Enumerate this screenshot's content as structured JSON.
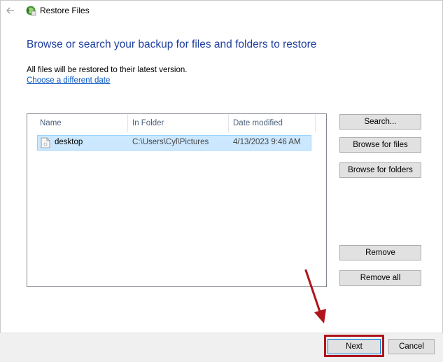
{
  "window": {
    "title": "Restore Files"
  },
  "heading": "Browse or search your backup for files and folders to restore",
  "info_text": "All files will be restored to their latest version.",
  "link_text": "Choose a different date",
  "list": {
    "columns": [
      "Name",
      "In Folder",
      "Date modified"
    ],
    "rows": [
      {
        "name": "desktop",
        "folder": "C:\\Users\\Cyl\\Pictures",
        "date": "4/13/2023 9:46 AM"
      }
    ]
  },
  "side_buttons": {
    "search": "Search...",
    "browse_files": "Browse for files",
    "browse_folders": "Browse for folders",
    "remove": "Remove",
    "remove_all": "Remove all"
  },
  "footer_buttons": {
    "next": "Next",
    "cancel": "Cancel"
  },
  "colors": {
    "heading": "#1e3e9e",
    "link": "#0a57c2",
    "selection": "#cce8ff",
    "annotation": "#b0141c"
  },
  "icons": [
    "back-arrow-icon",
    "restore-files-icon",
    "file-icon",
    "annotation-arrow-icon"
  ]
}
